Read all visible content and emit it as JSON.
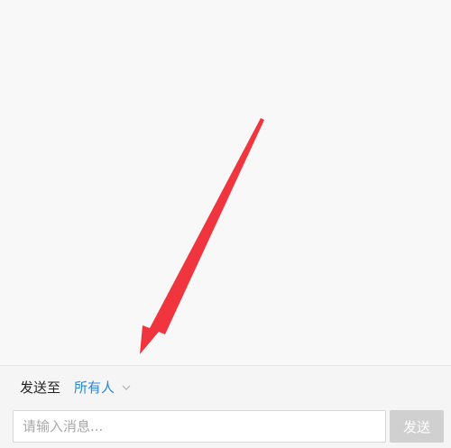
{
  "colors": {
    "background": "#f8f8f8",
    "accent": "#2d86d8",
    "annotation_arrow": "#f0353f",
    "send_button_disabled": "#d0d0d0"
  },
  "composer": {
    "send_to_label": "发送至",
    "recipient": {
      "selected": "所有人",
      "icon": "chevron-down-icon"
    },
    "message_input": {
      "value": "",
      "placeholder": "请输入消息..."
    },
    "send_label": "发送"
  }
}
